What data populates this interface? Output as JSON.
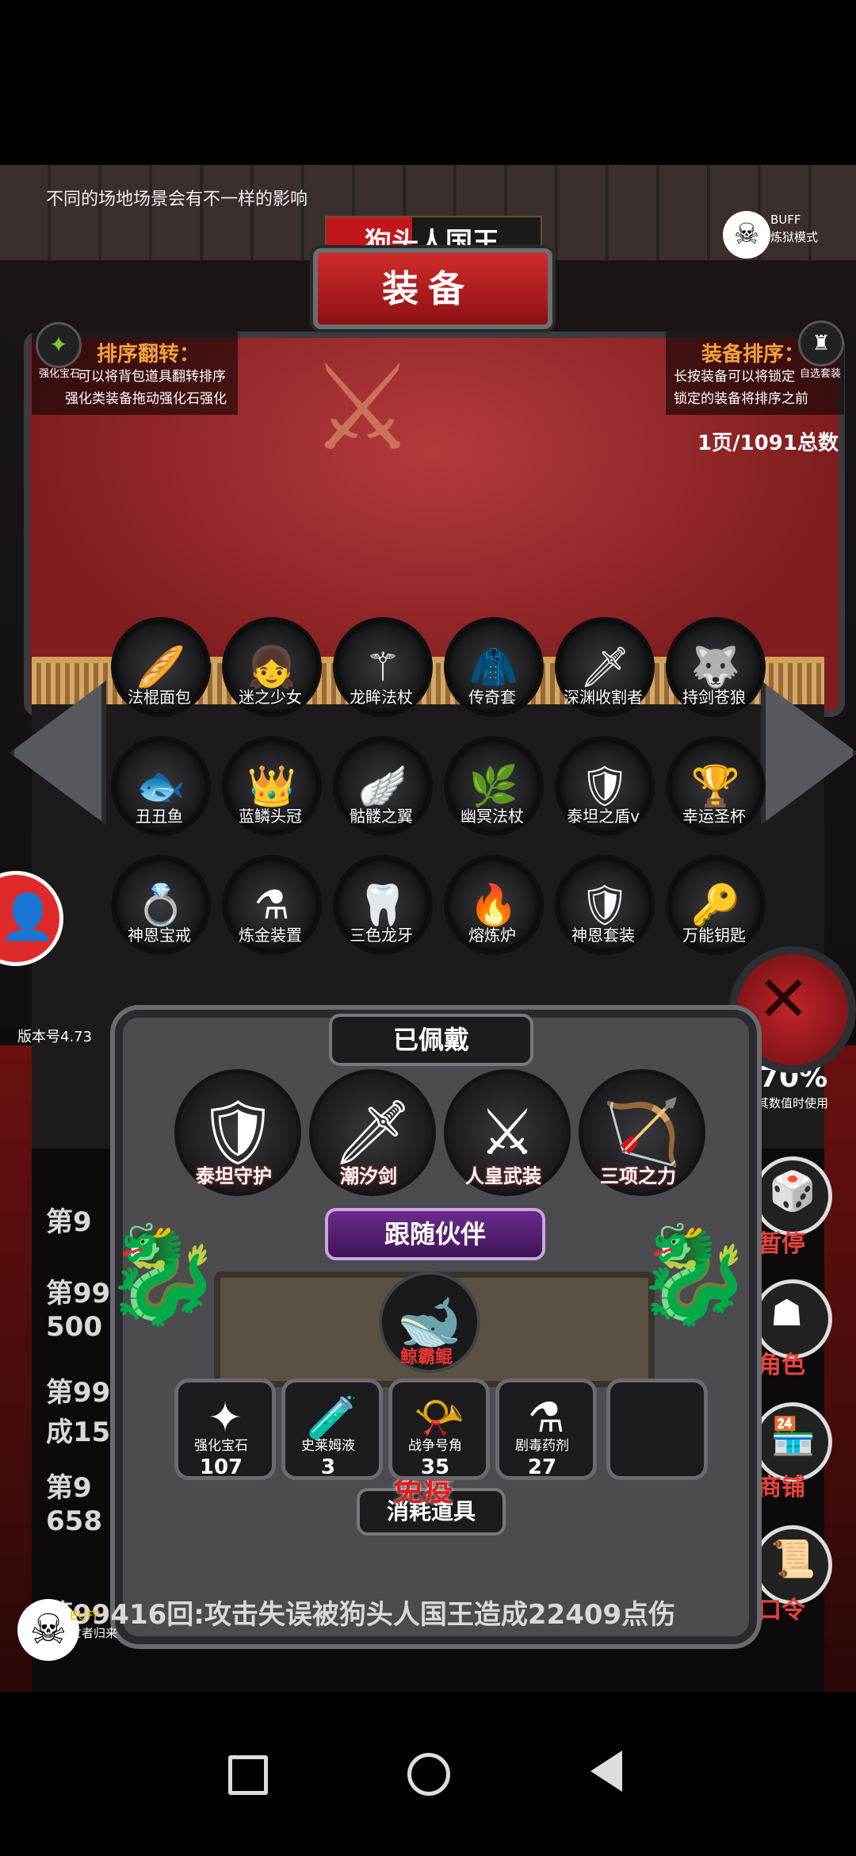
{
  "hint_text": "不同的场地场景会有不一样的影响",
  "boss_name": "狗头人国王",
  "panel_title": "装备",
  "buff_top": {
    "label": "BUFF",
    "mode": "炼狱模式"
  },
  "left_tool": {
    "icon": "强化宝石",
    "title": "排序翻转：",
    "lines": [
      "可以将背包道具翻转排序",
      "强化类装备拖动强化石强化"
    ]
  },
  "right_tool": {
    "icon": "自选套装",
    "title": "装备排序：",
    "lines": [
      "长按装备可以将锁定",
      "锁定的装备将排序之前"
    ]
  },
  "page_info": "1页/1091总数",
  "items": [
    {
      "label": "法棍面包",
      "icon": "🥖"
    },
    {
      "label": "迷之少女",
      "icon": "👧"
    },
    {
      "label": "龙眸法杖",
      "icon": "⚚"
    },
    {
      "label": "传奇套",
      "icon": "🧥"
    },
    {
      "label": "深渊收割者",
      "icon": "🗡"
    },
    {
      "label": "持剑苍狼",
      "icon": "🐺"
    },
    {
      "label": "丑丑鱼",
      "icon": "🐟"
    },
    {
      "label": "蓝鳞头冠",
      "icon": "👑"
    },
    {
      "label": "骷髅之翼",
      "icon": "🪽"
    },
    {
      "label": "幽冥法杖",
      "icon": "🌿"
    },
    {
      "label": "泰坦之盾v",
      "icon": "🛡"
    },
    {
      "label": "幸运圣杯",
      "icon": "🏆"
    },
    {
      "label": "神恩宝戒",
      "icon": "💍"
    },
    {
      "label": "炼金装置",
      "icon": "⚗"
    },
    {
      "label": "三色龙牙",
      "icon": "🦷"
    },
    {
      "label": "熔炼炉",
      "icon": "🔥"
    },
    {
      "label": "神恩套装",
      "icon": "🛡"
    },
    {
      "label": "万能钥匙",
      "icon": "🔑"
    }
  ],
  "version": "版本号4.73",
  "log_lines": [
    "第9",
    "第99+",
    "500",
    "第99",
    "成15",
    "第9",
    "658",
    "第99416回:攻击失误被狗头人国王造成22409点伤"
  ],
  "equipped_title": "已佩戴",
  "equipped": [
    {
      "label": "泰坦守护",
      "icon": "🛡"
    },
    {
      "label": "潮汐剑",
      "icon": "🗡"
    },
    {
      "label": "人皇武装",
      "icon": "⚔"
    },
    {
      "label": "三项之力",
      "icon": "🏹"
    }
  ],
  "companion_title": "跟随伙伴",
  "companion": {
    "label": "鲸霸鲲",
    "icon": "🐋"
  },
  "consumables": [
    {
      "label": "强化宝石",
      "count": "107",
      "icon": "✦"
    },
    {
      "label": "史莱姆液",
      "count": "3",
      "icon": "🧪"
    },
    {
      "label": "战争号角",
      "count": "35",
      "icon": "📯"
    },
    {
      "label": "剧毒药剂",
      "count": "27",
      "icon": "⚗"
    }
  ],
  "consumables_title": "消耗道具",
  "immune_text": "免疫",
  "stat_value": "70%",
  "stat_note": "其数值时使用",
  "right_menu": [
    "暂停",
    "角色",
    "商铺",
    "口令"
  ],
  "buff_bottom": {
    "label": "BUFF",
    "text": "亡者归来"
  }
}
